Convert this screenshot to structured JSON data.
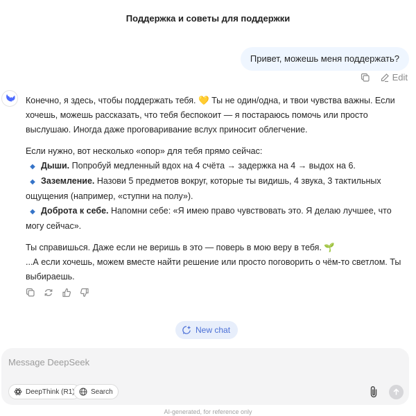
{
  "header": {
    "title": "Поддержка и советы для поддержки"
  },
  "user_message": {
    "text": "Привет, можешь меня поддержать?",
    "actions": {
      "copy_icon": "copy-icon",
      "edit_label": "Edit",
      "edit_icon": "pencil-icon"
    }
  },
  "assistant": {
    "avatar_icon": "deepseek-whale-icon",
    "intro": {
      "part1": "Конечно, я здесь, чтобы поддержать тебя.",
      "emoji": "💛",
      "part2": "Ты не один/одна, и твои чувства важны. Если хочешь, можешь рассказать, что тебя беспокоит — я постараюсь помочь или просто выслушаю. Иногда даже проговаривание вслух приносит облегчение."
    },
    "anchors_intro": "Если нужно, вот несколько «опор» для тебя прямо сейчас:",
    "bullets": [
      {
        "title": "Дыши.",
        "text": "Попробуй медленный вдох на 4 счёта → задержка на 4 → выдох на 6."
      },
      {
        "title": "Заземление.",
        "text": "Назови 5 предметов вокруг, которые ты видишь, 4 звука, 3 тактильных ощущения (например, «ступни на полу»)."
      },
      {
        "title": "Доброта к себе.",
        "text": "Напомни себе: «Я имею право чувствовать это. Я делаю лучшее, что могу сейчас»."
      }
    ],
    "closing_line1": "Ты справишься. Даже если не веришь в это — поверь в мою веру в тебя.",
    "closing_emoji": "🌱",
    "closing_line2": "...А если хочешь, можем вместе найти решение или просто поговорить о чём-то светлом. Ты выбираешь.",
    "actions": [
      "copy-icon",
      "regenerate-icon",
      "thumbs-up-icon",
      "thumbs-down-icon"
    ]
  },
  "new_chat": {
    "label": "New chat",
    "icon": "new-chat-icon"
  },
  "composer": {
    "placeholder": "Message DeepSeek",
    "value": "",
    "deepthink_label": "DeepThink (R1)",
    "search_label": "Search",
    "attach_icon": "paperclip-icon",
    "send_icon": "arrow-up-icon"
  },
  "footer": {
    "disclaimer": "AI-generated, for reference only"
  },
  "colors": {
    "accent": "#4d6bfe",
    "user_bubble": "#eff6ff",
    "new_chat_bg": "#e7eefb",
    "bullet": "#3674c8"
  }
}
